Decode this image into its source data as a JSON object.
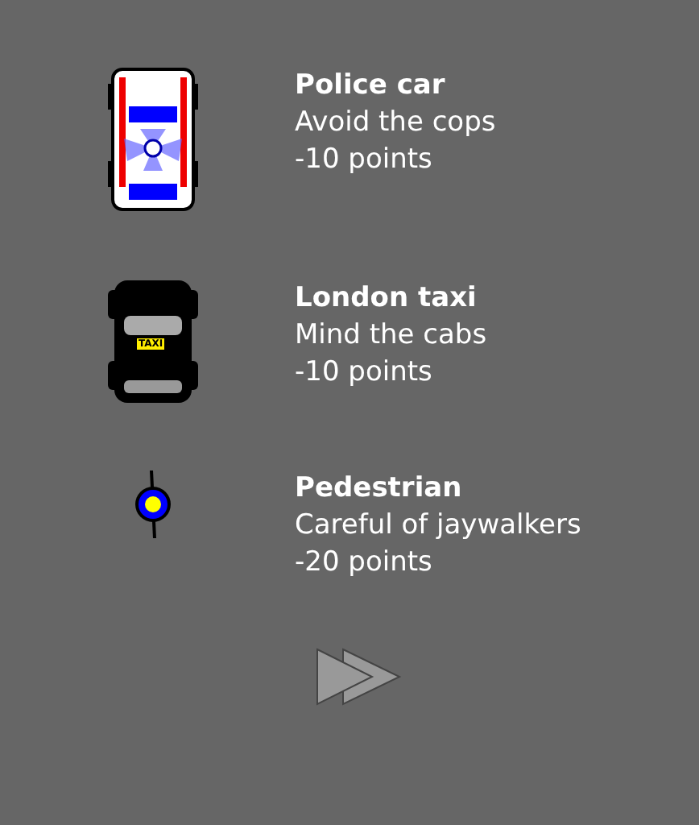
{
  "entries": [
    {
      "kind": "police",
      "title": "Police car",
      "subtitle": "Avoid the cops",
      "points": "-10 points"
    },
    {
      "kind": "taxi",
      "sign": "TAXI",
      "title": "London taxi",
      "subtitle": "Mind the cabs",
      "points": "-10 points"
    },
    {
      "kind": "pedestrian",
      "title": "Pedestrian",
      "subtitle": "Careful of jaywalkers",
      "points": "-20 points"
    }
  ]
}
